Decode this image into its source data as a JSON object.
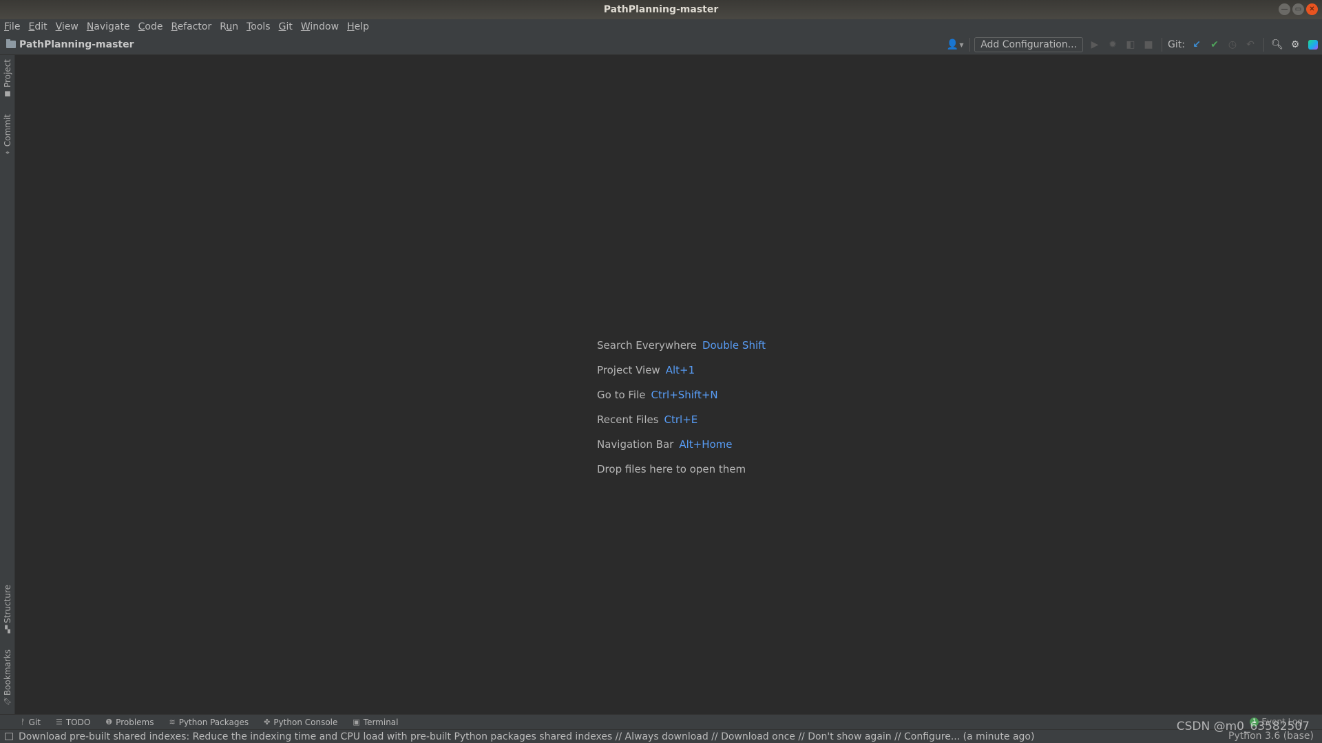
{
  "window": {
    "title": "PathPlanning-master",
    "controls": [
      "minimize",
      "maximize",
      "close"
    ]
  },
  "menu": {
    "items": [
      {
        "label": "File",
        "mnemonic": "F"
      },
      {
        "label": "Edit",
        "mnemonic": "E"
      },
      {
        "label": "View",
        "mnemonic": "V"
      },
      {
        "label": "Navigate",
        "mnemonic": "N"
      },
      {
        "label": "Code",
        "mnemonic": "C"
      },
      {
        "label": "Refactor",
        "mnemonic": "R"
      },
      {
        "label": "Run",
        "mnemonic": "u"
      },
      {
        "label": "Tools",
        "mnemonic": "T"
      },
      {
        "label": "Git",
        "mnemonic": "G"
      },
      {
        "label": "Window",
        "mnemonic": "W"
      },
      {
        "label": "Help",
        "mnemonic": "H"
      }
    ]
  },
  "navbar": {
    "project_name": "PathPlanning-master",
    "add_configuration_label": "Add Configuration...",
    "git_label": "Git:",
    "icons": {
      "user": "user-icon",
      "run": "run-icon",
      "debug": "debug-icon",
      "coverage": "coverage-icon",
      "stop": "stop-icon",
      "git_update": "git-update-icon",
      "git_commit": "git-commit-icon",
      "git_history": "git-history-icon",
      "git_rollback": "git-rollback-icon",
      "search": "search-icon",
      "settings": "gear-icon",
      "toolbox": "jetbrains-toolbox-icon"
    },
    "colors": {
      "git_update": "#3d8fd6",
      "git_commit": "#4fa35b"
    }
  },
  "left_strip": {
    "top_tabs": [
      {
        "label": "Project",
        "icon": "folder-icon"
      },
      {
        "label": "Commit",
        "icon": "commit-icon"
      }
    ],
    "bottom_tabs": [
      {
        "label": "Structure",
        "icon": "structure-icon"
      },
      {
        "label": "Bookmarks",
        "icon": "bookmark-icon"
      }
    ]
  },
  "editor": {
    "hints": [
      {
        "action": "Search Everywhere",
        "shortcut": "Double Shift"
      },
      {
        "action": "Project View",
        "shortcut": "Alt+1"
      },
      {
        "action": "Go to File",
        "shortcut": "Ctrl+Shift+N"
      },
      {
        "action": "Recent Files",
        "shortcut": "Ctrl+E"
      },
      {
        "action": "Navigation Bar",
        "shortcut": "Alt+Home"
      },
      {
        "action": "Drop files here to open them",
        "shortcut": ""
      }
    ],
    "shortcut_color": "#589df6"
  },
  "tool_tabs": [
    {
      "label": "Git",
      "icon": "git-branch-icon"
    },
    {
      "label": "TODO",
      "icon": "list-icon"
    },
    {
      "label": "Problems",
      "icon": "problems-icon"
    },
    {
      "label": "Python Packages",
      "icon": "packages-icon"
    },
    {
      "label": "Python Console",
      "icon": "python-icon"
    },
    {
      "label": "Terminal",
      "icon": "terminal-icon"
    }
  ],
  "event_log": {
    "label": "Event Log",
    "count": "1"
  },
  "status_bar": {
    "message": "Download pre-built shared indexes: Reduce the indexing time and CPU load with pre-built Python packages shared indexes // Always download // Download once // Don't show again // Configure... (a minute ago)",
    "interpreter": "Python 3.6 (base)"
  },
  "watermark": "CSDN @m0_63582507"
}
